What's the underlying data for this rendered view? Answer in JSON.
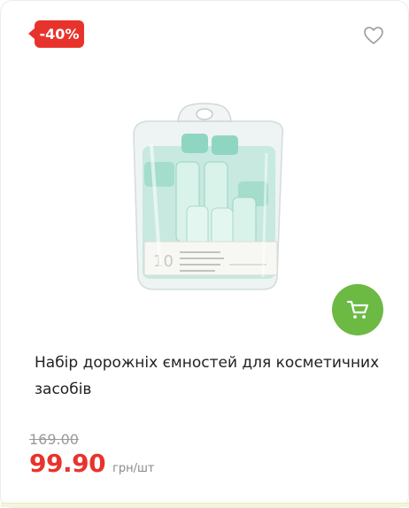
{
  "badge": {
    "discount": "-40%"
  },
  "product": {
    "title": "Набір дорожніх ємностей для косметичних засобів",
    "image_icon": "travel-bottles-set-image",
    "package_label": "10"
  },
  "pricing": {
    "old_price": "169.00",
    "price": "99.90",
    "unit": "грн/шт"
  },
  "icons": {
    "favorite": "heart-outline-icon",
    "cart": "shopping-cart-icon"
  },
  "colors": {
    "badge": "#e8332c",
    "price": "#e8332c",
    "cart_button": "#6cb944",
    "old_price": "#9a9a9a"
  }
}
